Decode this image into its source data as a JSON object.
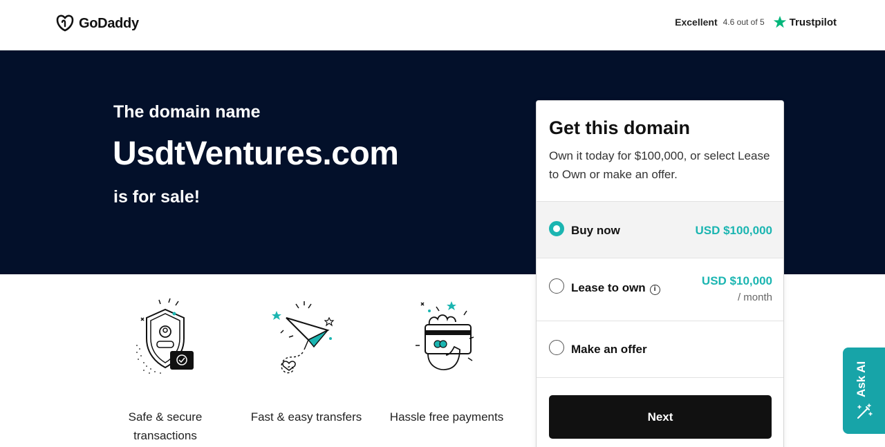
{
  "header": {
    "brand": "GoDaddy",
    "trustpilot": {
      "rating_word": "Excellent",
      "score_text": "4.6 out of 5",
      "brand": "Trustpilot",
      "star_color": "#00b67a"
    }
  },
  "hero": {
    "intro": "The domain name",
    "domain": "UsdtVentures.com",
    "suffix": "is for sale!",
    "background": "#03102a"
  },
  "features": [
    {
      "icon": "shield-icon",
      "label_line1": "Safe & secure",
      "label_line2": "transactions"
    },
    {
      "icon": "paper-plane-icon",
      "label_line1": "Fast & easy transfers",
      "label_line2": ""
    },
    {
      "icon": "payment-card-icon",
      "label_line1": "Hassle free payments",
      "label_line2": ""
    }
  ],
  "card": {
    "title": "Get this domain",
    "description": "Own it today for $100,000, or select Lease to Own or make an offer.",
    "options": [
      {
        "label": "Buy now",
        "price": "USD $100,000",
        "selected": true
      },
      {
        "label": "Lease to own",
        "price": "USD $10,000",
        "sub": "/ month",
        "selected": false
      },
      {
        "label": "Make an offer",
        "selected": false
      }
    ],
    "next_label": "Next"
  },
  "ask_ai": {
    "label": "Ask AI",
    "color": "#17a4a8"
  },
  "colors": {
    "accent": "#1bb5b1",
    "button": "#111111"
  }
}
